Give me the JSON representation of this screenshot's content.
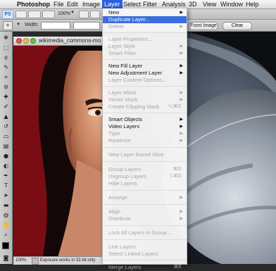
{
  "menubar": {
    "apple": "",
    "items": [
      "Photoshop",
      "File",
      "Edit",
      "Image",
      "Layer",
      "Select",
      "Filter",
      "Analysis",
      "3D",
      "View",
      "Window",
      "Help"
    ]
  },
  "appbar": {
    "app_badge": "PS",
    "zoom": "100%"
  },
  "options": {
    "width_label": "Width:",
    "front_image_button": "Front Image",
    "clear_button": "Clear"
  },
  "document": {
    "tab_title": "wikimedia_commons-mo",
    "zoom": "100%",
    "status_text": "Exposure works in 32-bit only"
  },
  "layer_menu": {
    "new": "New",
    "duplicate_layer": "Duplicate Layer...",
    "delete": "Delete",
    "layer_properties": "Layer Properties...",
    "layer_style": "Layer Style",
    "smart_filter": "Smart Filter",
    "new_fill_layer": "New Fill Layer",
    "new_adjustment_layer": "New Adjustment Layer",
    "layer_content_options": "Layer Content Options...",
    "layer_mask": "Layer Mask",
    "vector_mask": "Vector Mask",
    "create_clipping_mask": "Create Clipping Mask",
    "create_clipping_mask_shortcut": "⌥⌘G",
    "smart_objects": "Smart Objects",
    "video_layers": "Video Layers",
    "type": "Type",
    "rasterize": "Rasterize",
    "new_layer_based_slice": "New Layer Based Slice",
    "group_layers": "Group Layers",
    "group_layers_shortcut": "⌘G",
    "ungroup_layers": "Ungroup Layers",
    "ungroup_layers_shortcut": "⇧⌘G",
    "hide_layers": "Hide Layers",
    "arrange": "Arrange",
    "align": "Align",
    "distribute": "Distribute",
    "lock_all_layers": "Lock All Layers in Group...",
    "link_layers": "Link Layers",
    "select_linked_layers": "Select Linked Layers",
    "merge_layers": "Merge Layers",
    "merge_layers_shortcut": "⌘E"
  },
  "colors": {
    "menu_highlight": "#3a6fe0",
    "menubar_active": "#2b5fd9",
    "doc_background": "#7a0c13"
  }
}
